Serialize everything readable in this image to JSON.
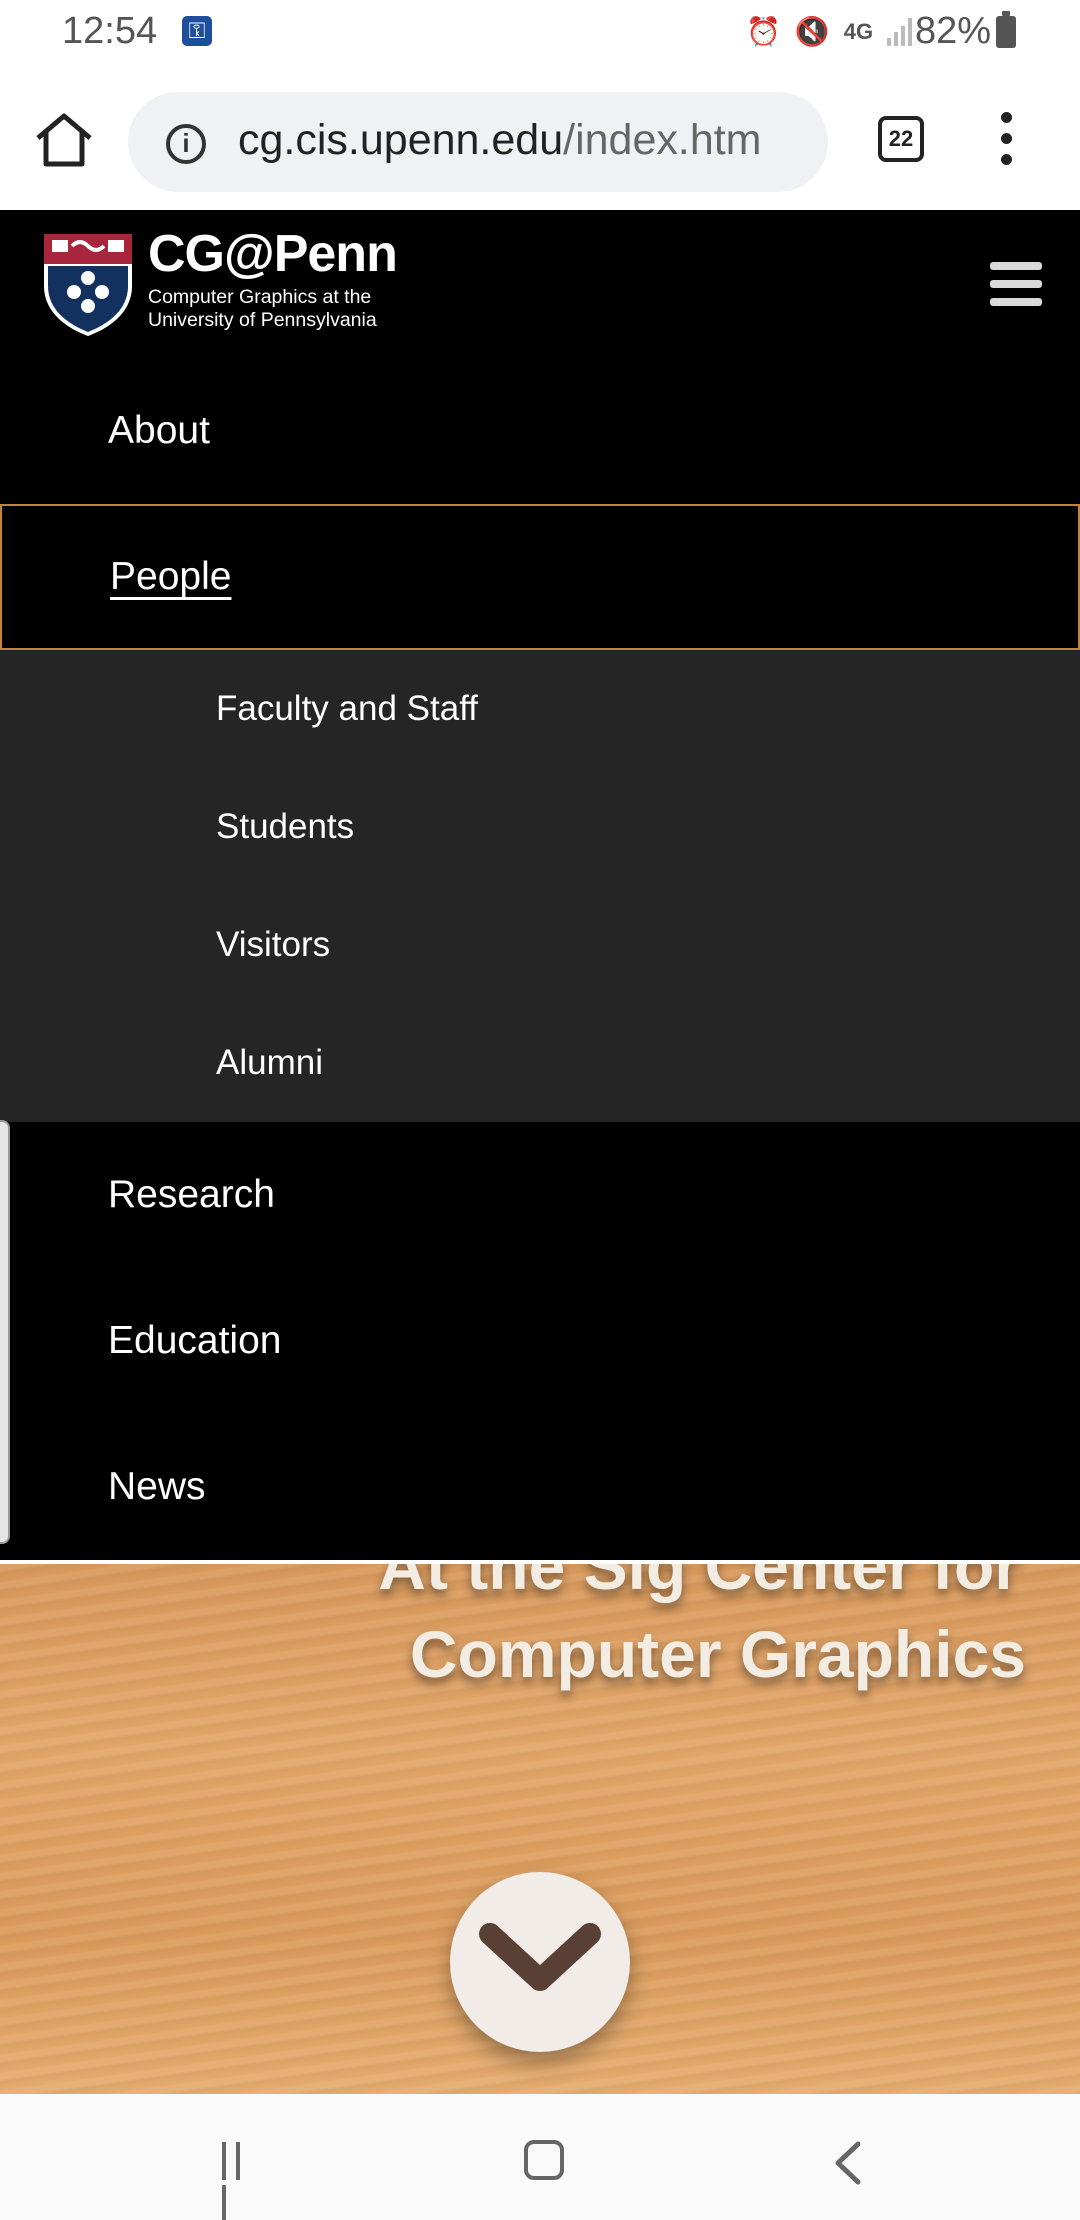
{
  "status_bar": {
    "time": "12:54",
    "network": "4G",
    "battery": "82%",
    "icons": [
      "key-icon",
      "alarm-icon",
      "mute-icon",
      "4g-icon",
      "signal-icon",
      "battery-icon"
    ]
  },
  "browser": {
    "url_host": "cg.cis.upenn.edu",
    "url_path": "/index.htm",
    "tab_count": "22"
  },
  "site": {
    "title": "CG@Penn",
    "subtitle_line1": "Computer Graphics at the",
    "subtitle_line2": "University of Pennsylvania"
  },
  "nav": {
    "about": "About",
    "people": "People",
    "people_sub": [
      "Faculty and Staff",
      "Students",
      "Visitors",
      "Alumni"
    ],
    "research": "Research",
    "education": "Education",
    "news": "News"
  },
  "hero": {
    "line1": "At the Sig Center for",
    "line2": "Computer Graphics"
  },
  "colors": {
    "nav_bg": "#000000",
    "submenu_bg": "#252525",
    "active_border": "#c4833b",
    "hero_wood": "#e0a466"
  }
}
